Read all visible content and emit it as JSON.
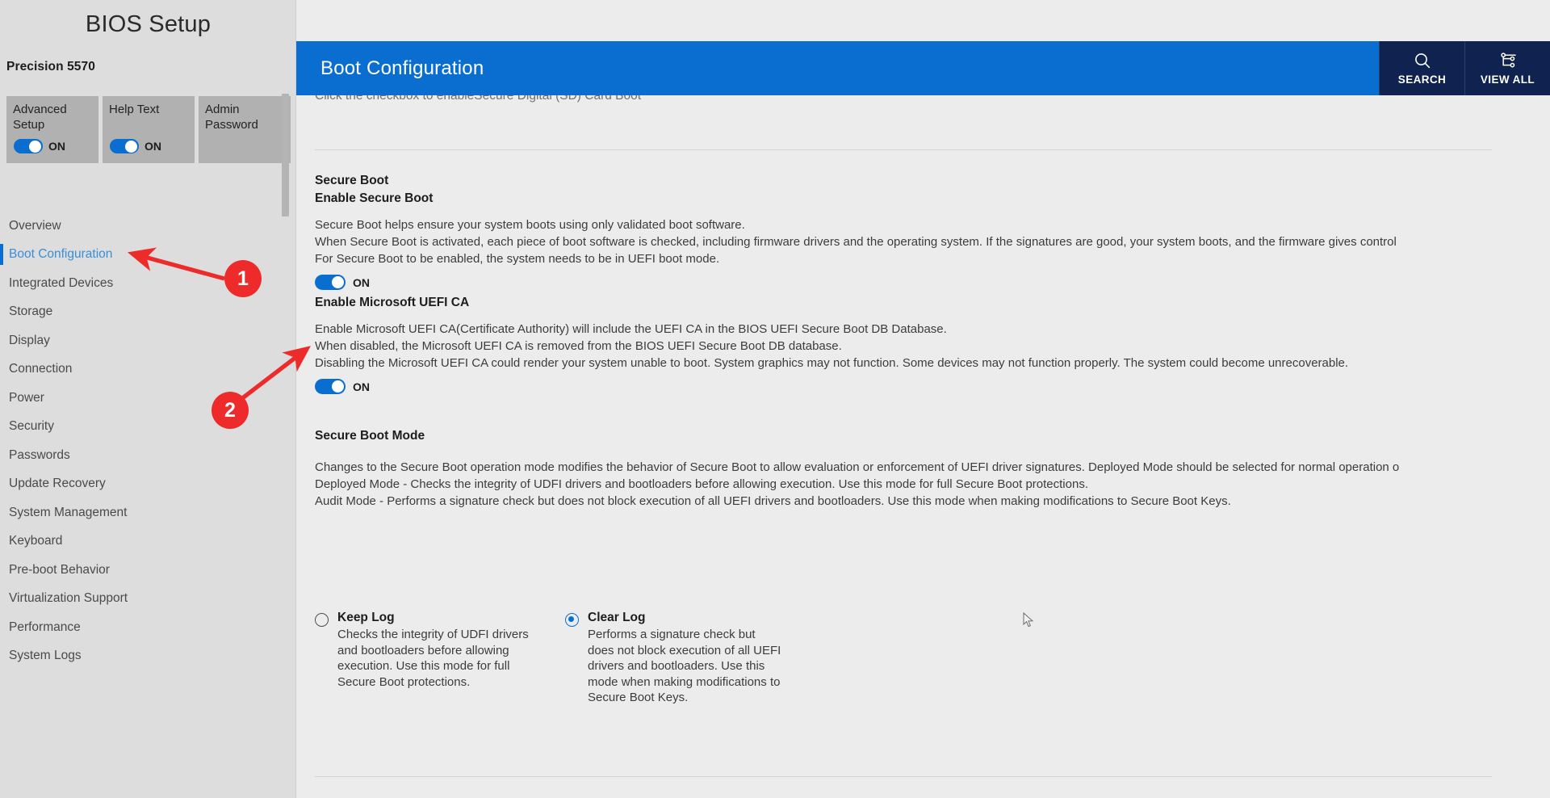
{
  "sidebar": {
    "title": "BIOS Setup",
    "model": "Precision 5570",
    "toggle_cards": [
      {
        "label": "Advanced Setup",
        "state": "ON",
        "has_toggle": true
      },
      {
        "label": "Help Text",
        "state": "ON",
        "has_toggle": true
      },
      {
        "label": "Admin Password",
        "state": "",
        "has_toggle": false
      }
    ],
    "items": [
      {
        "label": "Overview",
        "active": false
      },
      {
        "label": "Boot Configuration",
        "active": true
      },
      {
        "label": "Integrated Devices",
        "active": false
      },
      {
        "label": "Storage",
        "active": false
      },
      {
        "label": "Display",
        "active": false
      },
      {
        "label": "Connection",
        "active": false
      },
      {
        "label": "Power",
        "active": false
      },
      {
        "label": "Security",
        "active": false
      },
      {
        "label": "Passwords",
        "active": false
      },
      {
        "label": "Update Recovery",
        "active": false
      },
      {
        "label": "System Management",
        "active": false
      },
      {
        "label": "Keyboard",
        "active": false
      },
      {
        "label": "Pre-boot Behavior",
        "active": false
      },
      {
        "label": "Virtualization Support",
        "active": false
      },
      {
        "label": "Performance",
        "active": false
      },
      {
        "label": "System Logs",
        "active": false
      }
    ]
  },
  "header": {
    "title": "Boot Configuration",
    "actions": [
      {
        "label": "SEARCH",
        "icon": "search-icon"
      },
      {
        "label": "VIEW ALL",
        "icon": "view-all-tree-icon"
      }
    ]
  },
  "main": {
    "clipped_top_text": "Click the checkbox to enableSecure Digital (SD) Card Boot",
    "secure_boot": {
      "section_title": "Secure Boot",
      "sub_title": "Enable Secure Boot",
      "description_lines": [
        "Secure Boot helps ensure your system boots using only validated boot software.",
        "When Secure Boot is activated, each piece of boot software is checked, including firmware drivers and the operating system. If the signatures are good, your system boots, and the firmware gives control",
        "For Secure Boot to be enabled, the system needs to be in UEFI boot mode."
      ],
      "toggle_state": "ON"
    },
    "ms_uefi_ca": {
      "sub_title": "Enable Microsoft UEFI CA",
      "description_lines": [
        "Enable Microsoft UEFI CA(Certificate Authority) will include the UEFI CA in the BIOS UEFI Secure Boot DB Database.",
        "When disabled, the Microsoft UEFI CA is removed from the BIOS UEFI Secure Boot DB database.",
        "Disabling the Microsoft UEFI CA could render your system unable to boot. System graphics may not function. Some devices may not function properly. The system could become unrecoverable."
      ],
      "toggle_state": "ON"
    },
    "secure_boot_mode": {
      "sub_title": "Secure Boot Mode",
      "description_lines": [
        "Changes to the Secure Boot operation mode modifies the behavior of Secure Boot to allow evaluation or enforcement of UEFI driver signatures. Deployed Mode should be selected for normal operation o",
        "Deployed Mode - Checks the integrity of UDFI drivers and bootloaders before allowing execution. Use this mode for full Secure Boot protections.",
        "Audit Mode - Performs a signature check but does not block execution of all UEFI drivers and bootloaders. Use this mode when making modifications to Secure Boot Keys."
      ],
      "options": [
        {
          "label": "Keep Log",
          "selected": false,
          "description": "Checks the integrity of UDFI drivers and bootloaders before allowing execution. Use this mode for full Secure Boot protections."
        },
        {
          "label": "Clear Log",
          "selected": true,
          "description": "Performs a signature check but does not block execution of all UEFI drivers and bootloaders. Use this mode when making modifications to Secure Boot Keys."
        }
      ]
    }
  },
  "annotations": [
    {
      "number": "1",
      "target": "sidebar-item-boot-configuration"
    },
    {
      "number": "2",
      "target": "enable-secure-boot-toggle"
    }
  ],
  "colors": {
    "accent_blue": "#0a6ed1",
    "header_action_navy": "#0f2250",
    "sidebar_bg": "#dddddd",
    "main_bg": "#ececed",
    "annotation_red": "#ee2B2B",
    "active_nav_text": "#3a8fd6"
  }
}
